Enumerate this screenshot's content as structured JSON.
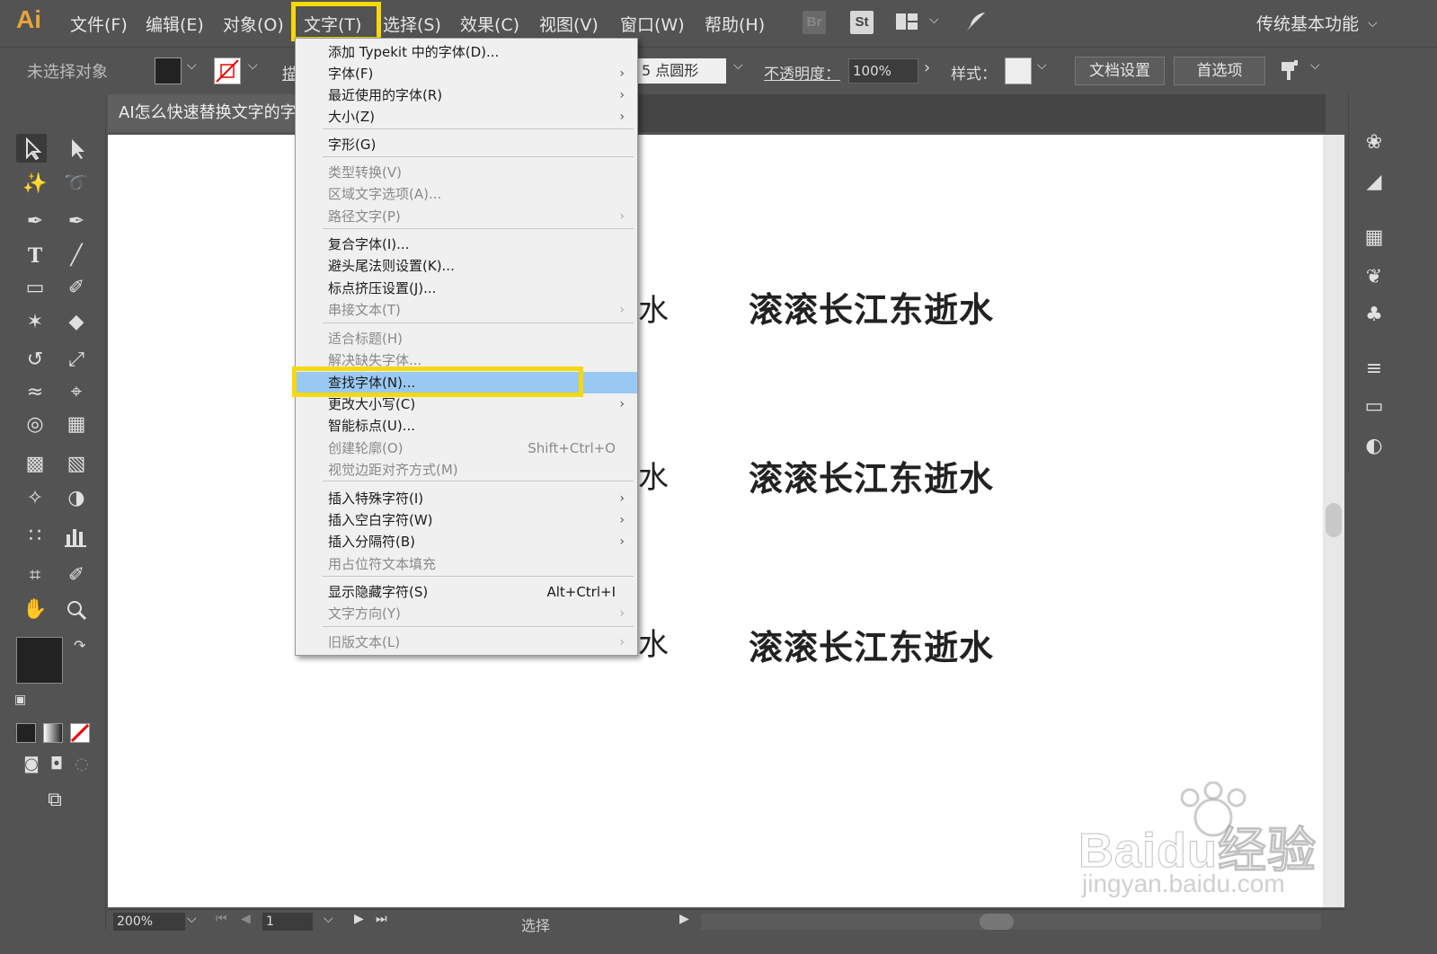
{
  "app": {
    "logo": "Ai",
    "workspace": "传统基本功能"
  },
  "menubar": {
    "items": [
      "文件(F)",
      "编辑(E)",
      "对象(O)",
      "文字(T)",
      "选择(S)",
      "效果(C)",
      "视图(V)",
      "窗口(W)",
      "帮助(H)"
    ],
    "bridge_label": "Br",
    "stock_label": "St"
  },
  "controlbar": {
    "selection": "未选择对象",
    "stroke_label": "描",
    "brush": "5 点圆形",
    "opacity_label": "不透明度：",
    "opacity_value": "100%",
    "style_label": "样式：",
    "doc_setup": "文档设置",
    "preferences": "首选项"
  },
  "document": {
    "tab_title": "AI怎么快速替换文字的字"
  },
  "canvas": {
    "lines": [
      "滚滚长江东逝水",
      "滚滚长江东逝水",
      "滚滚长江东逝水"
    ],
    "partial_char": "水"
  },
  "dropdown": {
    "items": [
      {
        "label": "添加 Typekit 中的字体(D)...",
        "disabled": false,
        "submenu": false,
        "shortcut": ""
      },
      {
        "label": "字体(F)",
        "disabled": false,
        "submenu": true,
        "shortcut": ""
      },
      {
        "label": "最近使用的字体(R)",
        "disabled": false,
        "submenu": true,
        "shortcut": ""
      },
      {
        "label": "大小(Z)",
        "disabled": false,
        "submenu": true,
        "shortcut": ""
      },
      {
        "label": "字形(G)",
        "disabled": false,
        "submenu": false,
        "shortcut": ""
      },
      {
        "label": "类型转换(V)",
        "disabled": true,
        "submenu": false,
        "shortcut": ""
      },
      {
        "label": "区域文字选项(A)...",
        "disabled": true,
        "submenu": false,
        "shortcut": ""
      },
      {
        "label": "路径文字(P)",
        "disabled": true,
        "submenu": true,
        "shortcut": ""
      },
      {
        "label": "复合字体(I)...",
        "disabled": false,
        "submenu": false,
        "shortcut": ""
      },
      {
        "label": "避头尾法则设置(K)...",
        "disabled": false,
        "submenu": false,
        "shortcut": ""
      },
      {
        "label": "标点挤压设置(J)...",
        "disabled": false,
        "submenu": false,
        "shortcut": ""
      },
      {
        "label": "串接文本(T)",
        "disabled": true,
        "submenu": true,
        "shortcut": ""
      },
      {
        "label": "适合标题(H)",
        "disabled": true,
        "submenu": false,
        "shortcut": ""
      },
      {
        "label": "解决缺失字体...",
        "disabled": true,
        "submenu": false,
        "shortcut": ""
      },
      {
        "label": "查找字体(N)...",
        "disabled": false,
        "submenu": false,
        "shortcut": "",
        "active": true
      },
      {
        "label": "更改大小写(C)",
        "disabled": false,
        "submenu": true,
        "shortcut": ""
      },
      {
        "label": "智能标点(U)...",
        "disabled": false,
        "submenu": false,
        "shortcut": ""
      },
      {
        "label": "创建轮廓(O)",
        "disabled": true,
        "submenu": false,
        "shortcut": "Shift+Ctrl+O"
      },
      {
        "label": "视觉边距对齐方式(M)",
        "disabled": true,
        "submenu": false,
        "shortcut": ""
      },
      {
        "label": "插入特殊字符(I)",
        "disabled": false,
        "submenu": true,
        "shortcut": ""
      },
      {
        "label": "插入空白字符(W)",
        "disabled": false,
        "submenu": true,
        "shortcut": ""
      },
      {
        "label": "插入分隔符(B)",
        "disabled": false,
        "submenu": true,
        "shortcut": ""
      },
      {
        "label": "用占位符文本填充",
        "disabled": true,
        "submenu": false,
        "shortcut": ""
      },
      {
        "label": "显示隐藏字符(S)",
        "disabled": false,
        "submenu": false,
        "shortcut": "Alt+Ctrl+I"
      },
      {
        "label": "文字方向(Y)",
        "disabled": true,
        "submenu": true,
        "shortcut": ""
      },
      {
        "label": "旧版文本(L)",
        "disabled": true,
        "submenu": true,
        "shortcut": ""
      }
    ]
  },
  "statusbar": {
    "zoom": "200%",
    "page": "1",
    "status": "选择"
  },
  "watermark": {
    "main": "Baidu经验",
    "sub": "jingyan.baidu.com"
  },
  "colors": {
    "highlight": "#f5d90a",
    "active_item": "#99c9f2",
    "logo": "#e8a33b"
  }
}
